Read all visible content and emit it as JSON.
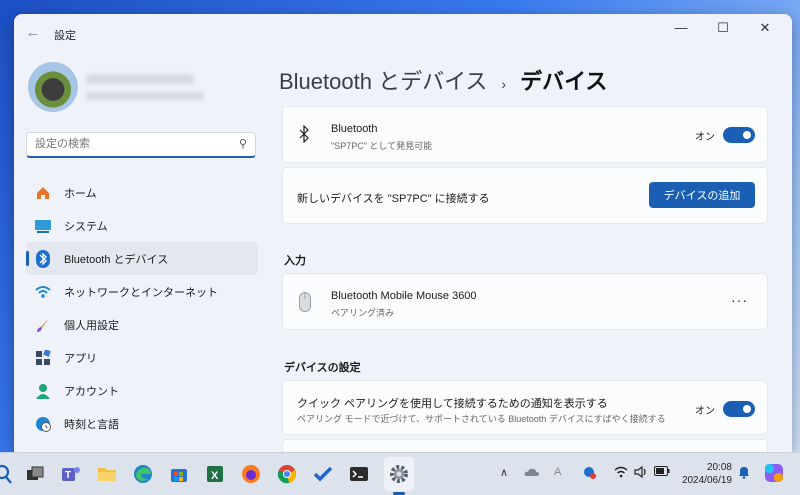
{
  "window": {
    "title": "設定",
    "controls": {
      "minimize": "—",
      "maximize": "☐",
      "close": "✕"
    }
  },
  "sidebar": {
    "search_placeholder": "設定の検索",
    "items": [
      {
        "label": "ホーム",
        "icon": "home-icon"
      },
      {
        "label": "システム",
        "icon": "system-icon"
      },
      {
        "label": "Bluetooth とデバイス",
        "icon": "bluetooth-icon",
        "active": true
      },
      {
        "label": "ネットワークとインターネット",
        "icon": "wifi-icon"
      },
      {
        "label": "個人用設定",
        "icon": "brush-icon"
      },
      {
        "label": "アプリ",
        "icon": "apps-icon"
      },
      {
        "label": "アカウント",
        "icon": "account-icon"
      },
      {
        "label": "時刻と言語",
        "icon": "globe-clock-icon"
      }
    ]
  },
  "main": {
    "breadcrumb": {
      "parent": "Bluetooth とデバイス",
      "separator": "›",
      "current": "デバイス"
    },
    "bluetooth": {
      "title": "Bluetooth",
      "subtitle": "\"SP7PC\" として発見可能",
      "toggle_label": "オン",
      "enabled": true
    },
    "add_device": {
      "text": "新しいデバイスを \"SP7PC\" に接続する",
      "button_label": "デバイスの追加"
    },
    "input_section": {
      "heading": "入力",
      "device_name": "Bluetooth Mobile Mouse 3600",
      "device_status": "ペアリング済み",
      "more_label": "···"
    },
    "device_settings": {
      "heading": "デバイスの設定",
      "swift_pair_title": "クイック ペアリングを使用して接続するための通知を表示する",
      "swift_pair_sub": "ペアリング モードで近づけて、サポートされている Bluetooth デバイスにすばやく接続する",
      "toggle_label": "オン",
      "enabled": true
    }
  },
  "taskbar": {
    "time": "20:08",
    "date": "2024/06/19",
    "tray_caret": "∧",
    "ime_label": "A"
  },
  "colors": {
    "accent": "#1a5fb4",
    "window_bg": "#eff3f9",
    "card_bg": "#fbfcfd"
  }
}
